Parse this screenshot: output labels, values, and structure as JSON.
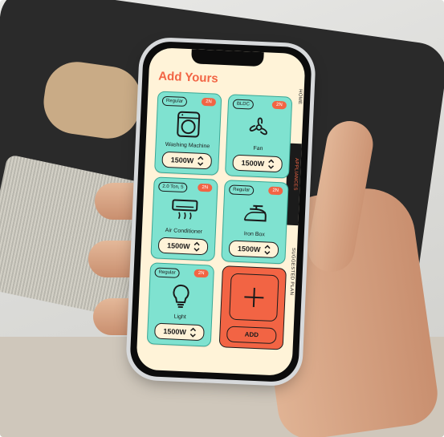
{
  "app": {
    "title": "Add Yours"
  },
  "sidebar": {
    "home": "HOME",
    "appliances": "APPLIANCES",
    "plan": "SUGGESTED PLAN"
  },
  "appliances": [
    {
      "name": "Washing Machine",
      "type": "Regular",
      "zone": "2N",
      "power": "1500W",
      "icon": "washing-machine-icon"
    },
    {
      "name": "Fan",
      "type": "BLDC",
      "zone": "2N",
      "power": "1500W",
      "icon": "fan-icon"
    },
    {
      "name": "Air Conditioner",
      "type": "2.0 Ton, 5",
      "zone": "2N",
      "power": "1500W",
      "icon": "air-conditioner-icon"
    },
    {
      "name": "Iron Box",
      "type": "Regular",
      "zone": "2N",
      "power": "1500W",
      "icon": "iron-box-icon"
    },
    {
      "name": "Light",
      "type": "Regular",
      "zone": "2N",
      "power": "1500W",
      "icon": "light-bulb-icon"
    }
  ],
  "add": {
    "label": "ADD"
  },
  "colors": {
    "accent": "#f26444",
    "card": "#7fe2d0",
    "background": "#fff3d8",
    "dark": "#1b1b1b"
  }
}
